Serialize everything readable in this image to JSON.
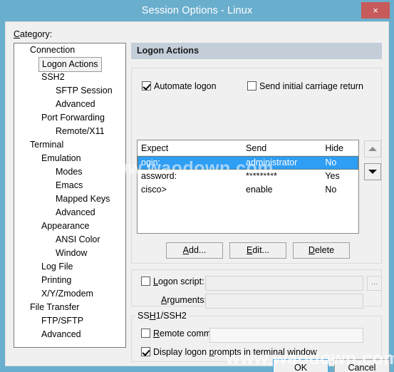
{
  "window": {
    "title": "Session Options - Linux",
    "close_label": "×",
    "titlebar_color": "#6aaecd",
    "close_color": "#c75a5a"
  },
  "category": {
    "label": "Category:",
    "items": [
      {
        "text": "Connection",
        "indent": 0,
        "expander": true,
        "selected": false
      },
      {
        "text": "Logon Actions",
        "indent": 1,
        "expander": false,
        "selected": true
      },
      {
        "text": "SSH2",
        "indent": 1,
        "expander": true,
        "selected": false
      },
      {
        "text": "SFTP Session",
        "indent": 2,
        "expander": false,
        "selected": false
      },
      {
        "text": "Advanced",
        "indent": 2,
        "expander": false,
        "selected": false
      },
      {
        "text": "Port Forwarding",
        "indent": 1,
        "expander": true,
        "selected": false
      },
      {
        "text": "Remote/X11",
        "indent": 2,
        "expander": false,
        "selected": false
      },
      {
        "text": "Terminal",
        "indent": 0,
        "expander": true,
        "selected": false
      },
      {
        "text": "Emulation",
        "indent": 1,
        "expander": true,
        "selected": false
      },
      {
        "text": "Modes",
        "indent": 2,
        "expander": false,
        "selected": false
      },
      {
        "text": "Emacs",
        "indent": 2,
        "expander": false,
        "selected": false
      },
      {
        "text": "Mapped Keys",
        "indent": 2,
        "expander": false,
        "selected": false
      },
      {
        "text": "Advanced",
        "indent": 2,
        "expander": false,
        "selected": false
      },
      {
        "text": "Appearance",
        "indent": 1,
        "expander": true,
        "selected": false
      },
      {
        "text": "ANSI Color",
        "indent": 2,
        "expander": false,
        "selected": false
      },
      {
        "text": "Window",
        "indent": 2,
        "expander": false,
        "selected": false
      },
      {
        "text": "Log File",
        "indent": 1,
        "expander": false,
        "selected": false
      },
      {
        "text": "Printing",
        "indent": 1,
        "expander": false,
        "selected": false
      },
      {
        "text": "X/Y/Zmodem",
        "indent": 1,
        "expander": false,
        "selected": false
      },
      {
        "text": "File Transfer",
        "indent": 0,
        "expander": true,
        "selected": false
      },
      {
        "text": "FTP/SFTP",
        "indent": 1,
        "expander": false,
        "selected": false
      },
      {
        "text": "Advanced",
        "indent": 1,
        "expander": false,
        "selected": false
      }
    ]
  },
  "panel": {
    "header": "Logon Actions",
    "automate_logon": {
      "label": "Automate logon",
      "checked": true
    },
    "send_initial_cr": {
      "label": "Send initial carriage return",
      "checked": false
    },
    "list": {
      "columns": [
        "Expect",
        "Send",
        "Hide"
      ],
      "rows": [
        {
          "expect": "ogin:",
          "send": "administrator",
          "hide": "No",
          "selected": true
        },
        {
          "expect": "assword:",
          "send": "*********",
          "hide": "Yes",
          "selected": false
        },
        {
          "expect": "cisco>",
          "send": "enable",
          "hide": "No",
          "selected": false
        }
      ],
      "selection_color": "#2f9ef5"
    },
    "scroll_up_icon": "triangle-up-icon",
    "scroll_down_icon": "triangle-down-icon",
    "buttons": {
      "add": "Add...",
      "edit": "Edit...",
      "delete": "Delete"
    },
    "logon_script": {
      "label": "Logon script:",
      "checked": false,
      "value": "",
      "browse_label": "..."
    },
    "arguments": {
      "label": "Arguments:",
      "value": ""
    },
    "ssh_group": {
      "legend": "SSH1/SSH2",
      "remote_command": {
        "label": "Remote command:",
        "checked": false,
        "value": ""
      },
      "display_prompts": {
        "label": "Display logon prompts in terminal window",
        "checked": true
      }
    }
  },
  "footer": {
    "ok": "OK",
    "cancel": "Cancel"
  },
  "watermark": {
    "bottom": "www.waodown.com",
    "middle": "www.waodown.com"
  }
}
